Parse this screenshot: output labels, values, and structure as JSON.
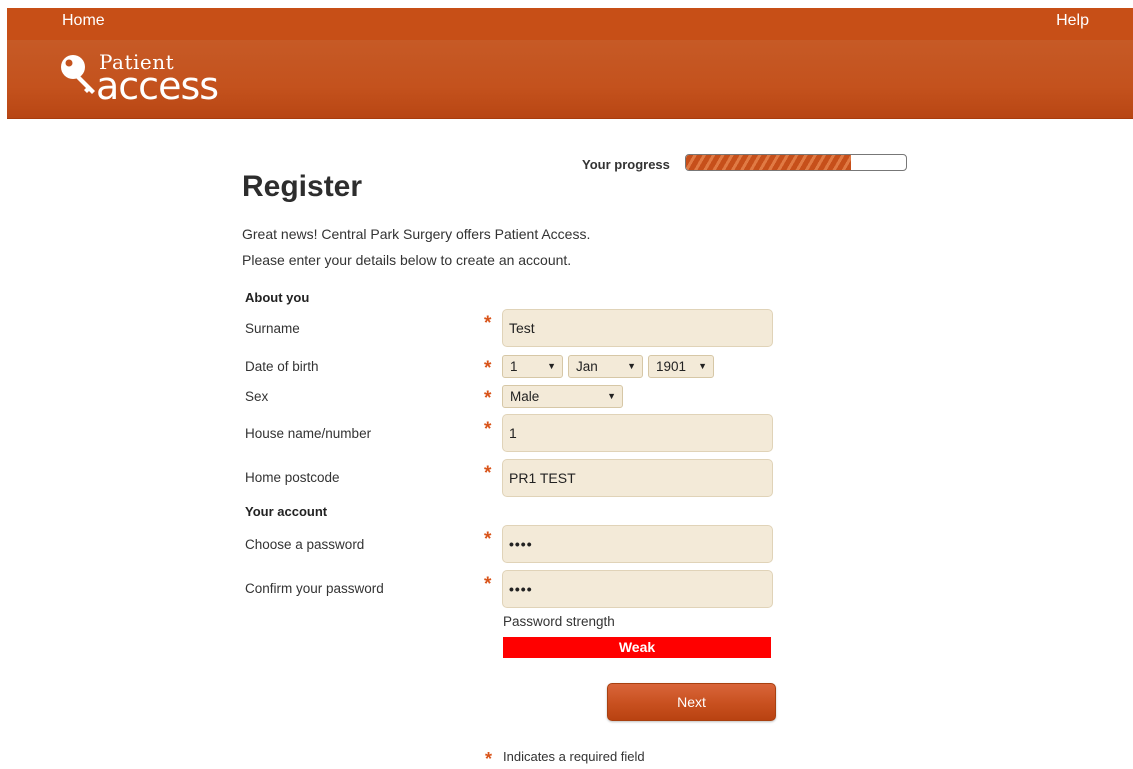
{
  "header": {
    "home_label": "Home",
    "help_label": "Help",
    "logo_small": "Patient",
    "logo_big": "access",
    "brand_color": "#c74f17"
  },
  "progress": {
    "label": "Your progress",
    "percent": 75
  },
  "page": {
    "title": "Register",
    "intro_line1": "Great news! Central Park Surgery offers Patient Access.",
    "intro_line2": "Please enter your details below to create an account."
  },
  "form": {
    "about_heading": "About you",
    "surname_label": "Surname",
    "surname_value": "Test",
    "dob_label": "Date of birth",
    "dob_day": "1",
    "dob_month": "Jan",
    "dob_year": "1901",
    "sex_label": "Sex",
    "sex_value": "Male",
    "house_label": "House name/number",
    "house_value": "1",
    "postcode_label": "Home postcode",
    "postcode_value": "PR1 TEST",
    "account_heading": "Your account",
    "password_label": "Choose a password",
    "password_value": "••••",
    "confirm_label": "Confirm your password",
    "confirm_value": "••••",
    "strength_label": "Password strength",
    "strength_value": "Weak",
    "strength_color": "#ff0000",
    "required_star": "*",
    "next_label": "Next",
    "required_note": "Indicates a required field"
  }
}
